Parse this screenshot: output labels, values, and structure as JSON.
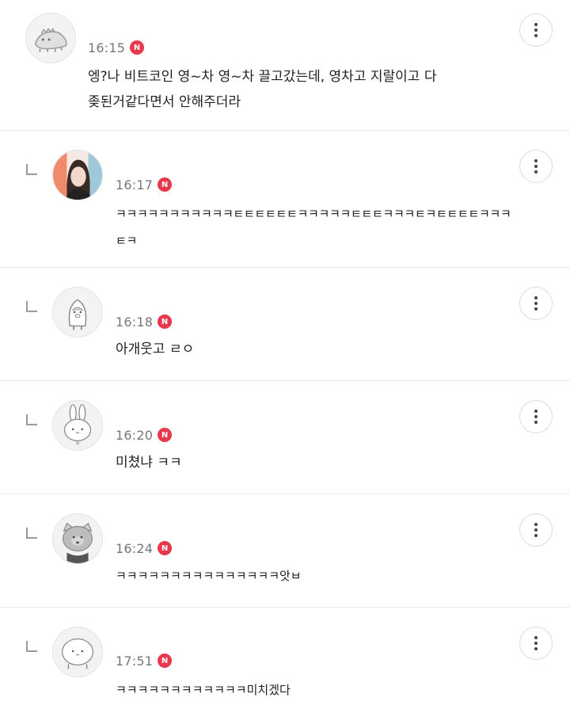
{
  "comments": [
    {
      "time": "16:15",
      "badge": "N",
      "text": "엥?나 비트코인 영~차 영~차 끌고갔는데, 영차고 지랄이고 다\n좆된거같다면서 안해주더라",
      "is_reply": false,
      "avatar_icon": "dinosaur-avatar-icon"
    },
    {
      "time": "16:17",
      "badge": "N",
      "text": "ㅋㅋㅋㅋㅋㅋㅋㅋㅋㅋㅋㅌㅌㅌㅌㅌㅌㅋㅋㅋㅋㅋㅌㅌㅌㅋㅋㅋㅌㅋㅌㅌㅌㅌㅋㅋㅋ\nㅌㅋ",
      "is_reply": true,
      "avatar_icon": "photo-avatar-icon"
    },
    {
      "time": "16:18",
      "badge": "N",
      "text": "아개웃고 ㄹㅇ",
      "is_reply": true,
      "avatar_icon": "penguin-avatar-icon"
    },
    {
      "time": "16:20",
      "badge": "N",
      "text": "미쳤냐 ㅋㅋ",
      "is_reply": true,
      "avatar_icon": "rabbit-avatar-icon"
    },
    {
      "time": "16:24",
      "badge": "N",
      "text": "ㅋㅋㅋㅋㅋㅋㅋㅋㅋㅋㅋㅋㅋㅋㅋ앗ㅂ",
      "is_reply": true,
      "avatar_icon": "cat-avatar-icon"
    },
    {
      "time": "17:51",
      "badge": "N",
      "text": "ㅋㅋㅋㅋㅋㅋㅋㅋㅋㅋㅋㅋ미치겠다",
      "is_reply": true,
      "avatar_icon": "bun-avatar-icon"
    }
  ],
  "colors": {
    "badge": "#e8384b",
    "timestamp": "#777777",
    "text": "#222222",
    "divider": "#e9e9e9"
  },
  "icons": {
    "more": "more-vertical-icon",
    "reply": "reply-arrow-icon",
    "new": "new-badge"
  }
}
